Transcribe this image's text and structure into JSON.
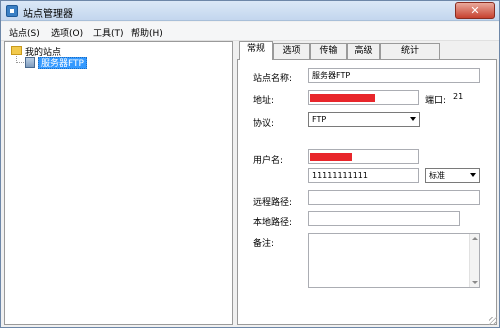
{
  "window": {
    "title": "站点管理器",
    "close_glyph": "✕"
  },
  "menu": [
    {
      "label": "站点(S)"
    },
    {
      "label": "选项(O)"
    },
    {
      "label": "工具(T)"
    },
    {
      "label": "帮助(H)"
    }
  ],
  "tree": {
    "root_label": "我的站点",
    "selected_item_label": "服务器FTP"
  },
  "tabs": [
    {
      "label": "常规"
    },
    {
      "label": "选项"
    },
    {
      "label": "传输"
    },
    {
      "label": "高级"
    },
    {
      "label": "统计"
    }
  ],
  "form": {
    "site_name_label": "站点名称:",
    "site_name_value": "服务器FTP",
    "address_label": "地址:",
    "port_label": "端口:",
    "port_value": "21",
    "protocol_label": "协议:",
    "protocol_value": "FTP",
    "username_label": "用户名:",
    "password_value": "11111111111",
    "login_type_value": "标准",
    "remote_path_label": "远程路径:",
    "local_path_label": "本地路径:",
    "notes_label": "备注:"
  },
  "colors": {
    "redaction": "#e8262b",
    "selection": "#3399ff",
    "tab_active": "#ffffff"
  },
  "icons": {
    "app": "window-app-icon",
    "folder": "folder-icon",
    "server": "server-icon",
    "dropdown": "chevron-down-icon"
  }
}
